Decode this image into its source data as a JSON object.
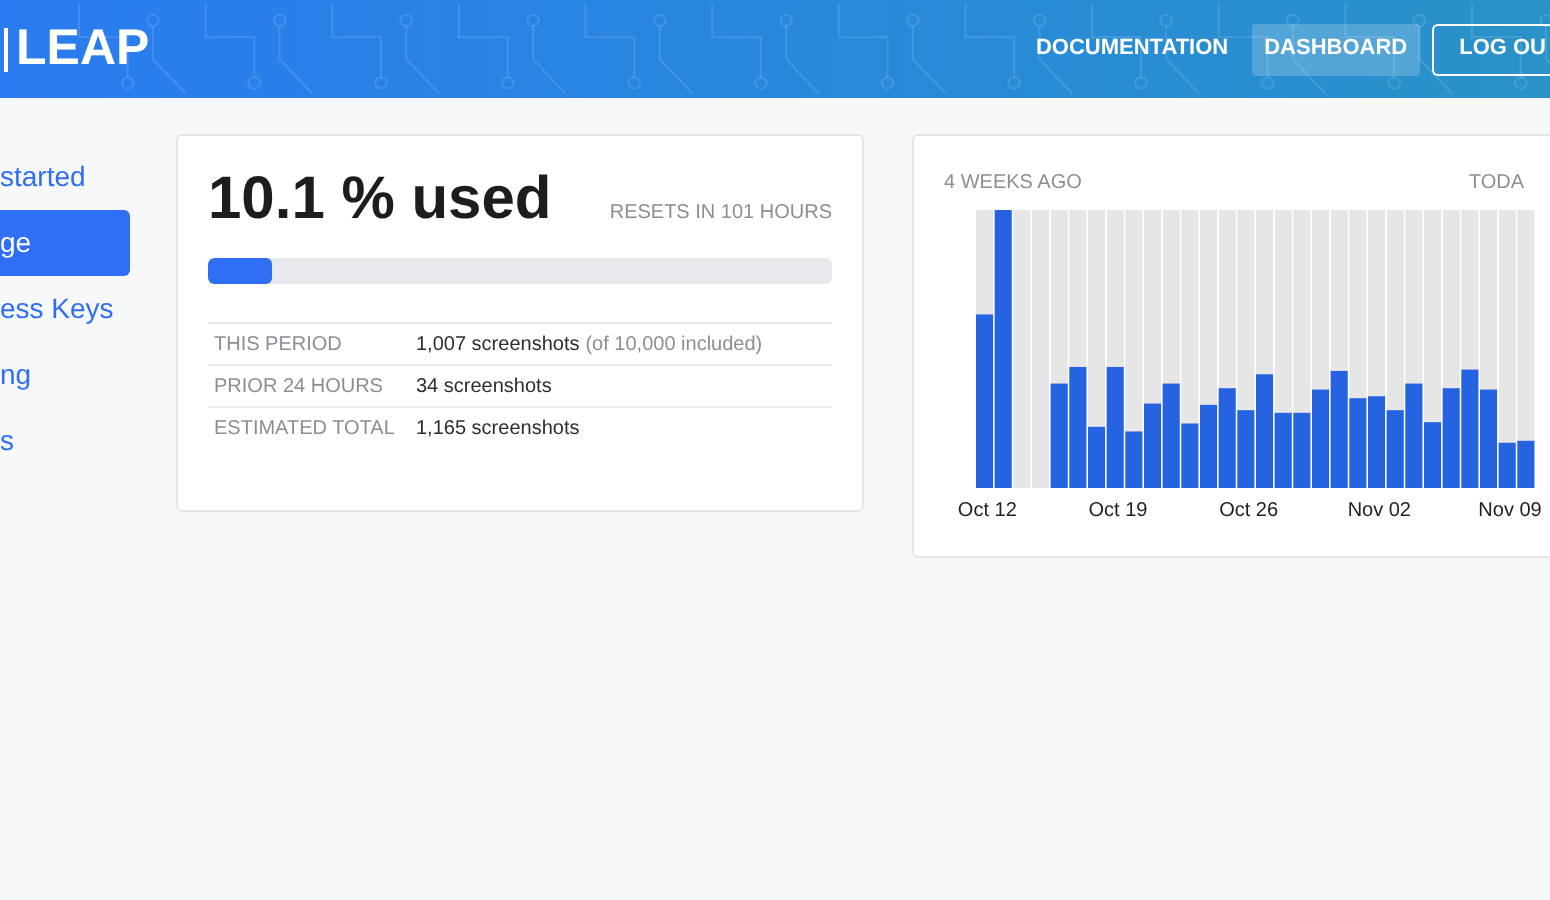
{
  "header": {
    "logo": "LEAP",
    "nav": [
      {
        "label": "DOCUMENTATION",
        "kind": "link",
        "selected": false
      },
      {
        "label": "DASHBOARD",
        "kind": "link",
        "selected": true
      },
      {
        "label": "LOG OU",
        "kind": "outline",
        "selected": false
      }
    ]
  },
  "sidebar": {
    "items": [
      {
        "label": "started",
        "selected": false
      },
      {
        "label": "ge",
        "selected": true
      },
      {
        "label": "ess Keys",
        "selected": false
      },
      {
        "label": "ng",
        "selected": false
      },
      {
        "label": "s",
        "selected": false
      }
    ]
  },
  "usage": {
    "title": "10.1 % used",
    "resets": "RESETS IN 101 HOURS",
    "level": 0.101,
    "rows": [
      {
        "label": "THIS PERIOD",
        "value": "1,007 screenshots",
        "note": "(of 10,000 included)"
      },
      {
        "label": "PRIOR 24 HOURS",
        "value": "34 screenshots"
      },
      {
        "label": "ESTIMATED TOTAL",
        "value": "1,165 screenshots"
      }
    ]
  },
  "history": {
    "start_label": "4 WEEKS AGO",
    "end_label": "TODA",
    "x_labels": [
      "Oct 12",
      "Oct 19",
      "Oct 26",
      "Nov 02",
      "Nov 09"
    ]
  }
}
